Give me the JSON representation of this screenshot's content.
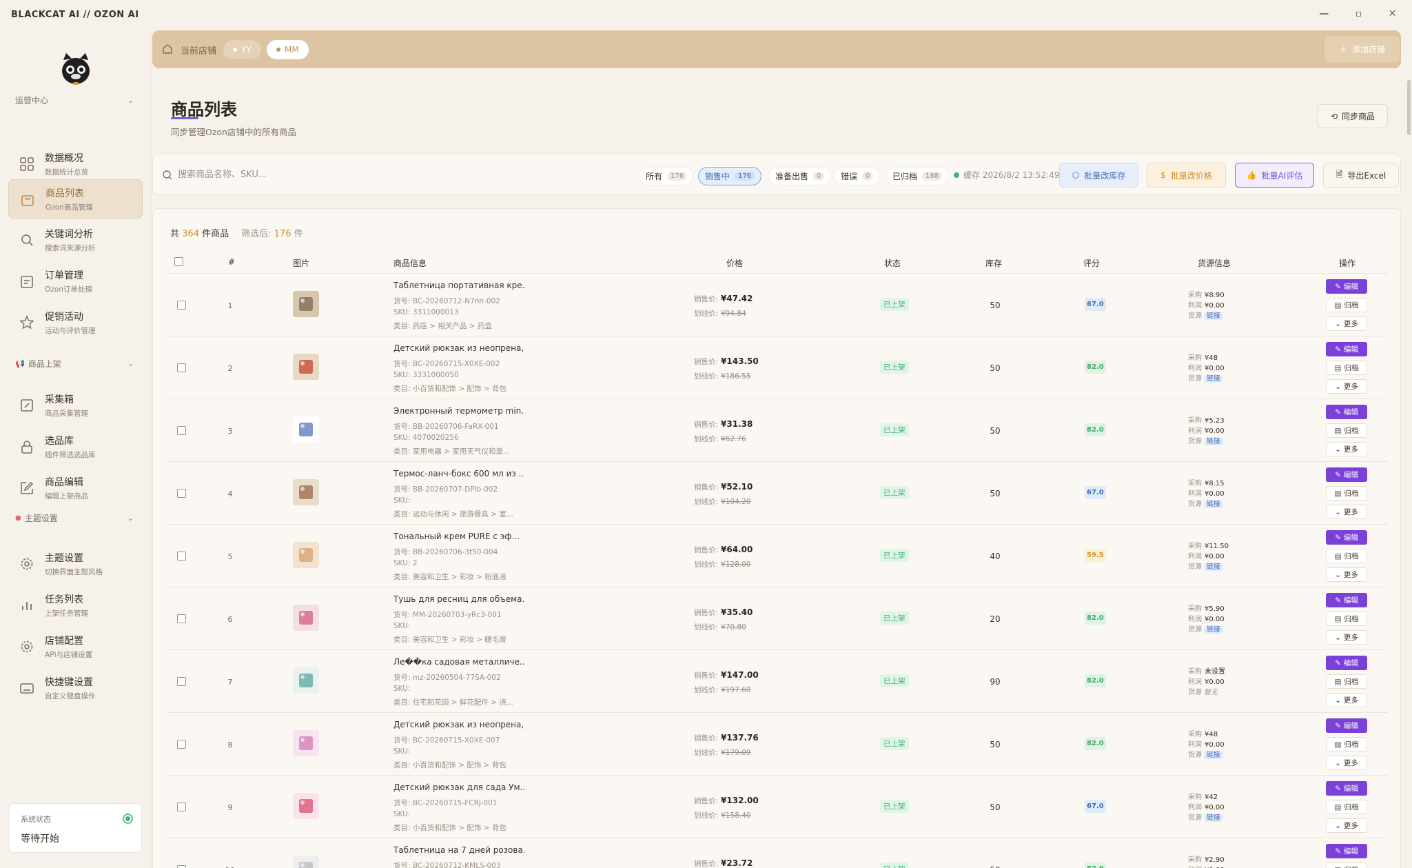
{
  "app": {
    "title": "BLACKCAT AI // OZON AI",
    "min": "—",
    "max": "▫",
    "close": "✕"
  },
  "sidebar": {
    "sections": [
      {
        "label": "运营中心"
      },
      {
        "label": "商品上架"
      },
      {
        "label": "主题设置"
      }
    ],
    "items": [
      {
        "label": "数据概况",
        "sub": "数据统计总览"
      },
      {
        "label": "商品列表",
        "sub": "Ozon商品管理"
      },
      {
        "label": "关键词分析",
        "sub": "搜索词来源分析"
      },
      {
        "label": "订单管理",
        "sub": "Ozon订单处理"
      },
      {
        "label": "促销活动",
        "sub": "活动与评价管理"
      },
      {
        "label": "采集箱",
        "sub": "商品采集管理"
      },
      {
        "label": "选品库",
        "sub": "插件筛选选品库"
      },
      {
        "label": "商品编辑",
        "sub": "编辑上架商品"
      },
      {
        "label": "主题设置",
        "sub": "切换界面主题风格"
      },
      {
        "label": "任务列表",
        "sub": "上架任务管理"
      },
      {
        "label": "店铺配置",
        "sub": "API与店铺设置"
      },
      {
        "label": "快捷键设置",
        "sub": "自定义键盘操作"
      }
    ],
    "status": {
      "label": "系统状态",
      "value": "等待开始"
    }
  },
  "topbar": {
    "current_store": "当前店铺",
    "stores": [
      "YY",
      "MM"
    ],
    "add_store": "添加店铺"
  },
  "page": {
    "title": "商品列表",
    "subtitle": "同步管理Ozon店铺中的所有商品",
    "sync": "同步商品"
  },
  "toolbar": {
    "search_placeholder": "搜索商品名称、SKU...",
    "tabs": [
      {
        "label": "所有",
        "count": "176"
      },
      {
        "label": "销售中",
        "count": "176"
      },
      {
        "label": "准备出售",
        "count": "0"
      },
      {
        "label": "错误",
        "count": "0"
      },
      {
        "label": "已归档",
        "count": "188"
      }
    ],
    "cache": "缓存 2026/8/2 13:52:49",
    "btn_stock": "批量改库存",
    "btn_price": "批量改价格",
    "btn_ai": "批量AI评估",
    "btn_excel": "导出Excel"
  },
  "summary": {
    "prefix": "共",
    "total": "364",
    "suffix": "件商品",
    "filtered_label": "筛选后:",
    "filtered": "176",
    "filtered_unit": "件"
  },
  "table": {
    "headers": [
      "#",
      "图片",
      "商品信息",
      "价格",
      "状态",
      "库存",
      "评分",
      "货源信息",
      "操作"
    ],
    "labels": {
      "sale": "销售价:",
      "strike": "划线价:",
      "buy": "采购",
      "profit": "利润",
      "source": "货源",
      "link": "链接",
      "edit": "编辑",
      "archive": "归档",
      "more": "更多"
    },
    "rows": [
      {
        "idx": "1",
        "name": "Таблетница портативная кре...",
        "code": "货号: BC-20260712-N7nn-002",
        "sku": "SKU: 3311000013",
        "cat": "类目: 药店 > 相关产品 > 药盒",
        "sale": "¥47.42",
        "strike": "¥94.84",
        "status": "已上架",
        "stock": "50",
        "score": "67.0",
        "score_color": "blue",
        "buy": "¥8.90",
        "profit": "¥0.00",
        "src": "链接"
      },
      {
        "idx": "2",
        "name": "Детский рюкзак из неопрена,...",
        "code": "货号: BC-20260715-X0XE-002",
        "sku": "SKU: 3331000050",
        "cat": "类目: 小百货和配饰 > 配饰 > 背包",
        "sale": "¥143.50",
        "strike": "¥186.55",
        "status": "已上架",
        "stock": "50",
        "score": "82.0",
        "score_color": "green",
        "buy": "¥48",
        "profit": "¥0.00",
        "src": "链接"
      },
      {
        "idx": "3",
        "name": "Электронный термометр min...",
        "code": "货号: BB-20260706-FaRX-001",
        "sku": "SKU: 4070020256",
        "cat": "类目: 家用电器 > 家用天气仪和温...",
        "sale": "¥31.38",
        "strike": "¥62.76",
        "status": "已上架",
        "stock": "50",
        "score": "82.0",
        "score_color": "green",
        "buy": "¥5.23",
        "profit": "¥0.00",
        "src": "链接"
      },
      {
        "idx": "4",
        "name": "Термос-ланч-бокс 600 мл из ...",
        "code": "货号: BB-20260707-DPlb-002",
        "sku": "SKU:",
        "cat": "类目: 运动与休闲 > 旅游餐具 > 室...",
        "sale": "¥52.10",
        "strike": "¥104.20",
        "status": "已上架",
        "stock": "50",
        "score": "67.0",
        "score_color": "blue",
        "buy": "¥8.15",
        "profit": "¥0.00",
        "src": "链接"
      },
      {
        "idx": "5",
        "name": "Тональный крем PURE с эф...",
        "code": "货号: BB-20260706-3t50-004",
        "sku": "SKU: 2",
        "cat": "类目: 美容和卫生 > 彩妆 > 粉底液",
        "sale": "¥64.00",
        "strike": "¥128.00",
        "status": "已上架",
        "stock": "40",
        "score": "59.5",
        "score_color": "orange",
        "buy": "¥11.50",
        "profit": "¥0.00",
        "src": "链接"
      },
      {
        "idx": "6",
        "name": "Тушь для ресниц для объема...",
        "code": "货号: MM-20260703-yRc3-001",
        "sku": "SKU:",
        "cat": "类目: 美容和卫生 > 彩妆 > 睫毛膏",
        "sale": "¥35.40",
        "strike": "¥70.80",
        "status": "已上架",
        "stock": "20",
        "score": "82.0",
        "score_color": "green",
        "buy": "¥5.90",
        "profit": "¥0.00",
        "src": "链接"
      },
      {
        "idx": "7",
        "name": "Ле��ка садовая металличе...",
        "code": "货号: mz-20260504-77SA-002",
        "sku": "SKU:",
        "cat": "类目: 住宅和花园 > 鲜花配件 > 浇...",
        "sale": "¥147.00",
        "strike": "¥197.60",
        "status": "已上架",
        "stock": "90",
        "score": "82.0",
        "score_color": "green",
        "buy": "未设置",
        "profit": "¥0.00",
        "src": "暂无"
      },
      {
        "idx": "8",
        "name": "Детский рюкзак из неопрена,...",
        "code": "货号: BC-20260715-X0XE-007",
        "sku": "SKU:",
        "cat": "类目: 小百货和配饰 > 配饰 > 背包",
        "sale": "¥137.76",
        "strike": "¥179.09",
        "status": "已上架",
        "stock": "50",
        "score": "82.0",
        "score_color": "green",
        "buy": "¥48",
        "profit": "¥0.00",
        "src": "链接"
      },
      {
        "idx": "9",
        "name": "Детский рюкзак для сада Ум...",
        "code": "货号: BC-20260715-FCRJ-001",
        "sku": "SKU:",
        "cat": "类目: 小百货和配饰 > 配饰 > 背包",
        "sale": "¥132.00",
        "strike": "¥158.40",
        "status": "已上架",
        "stock": "50",
        "score": "67.0",
        "score_color": "blue",
        "buy": "¥42",
        "profit": "¥0.00",
        "src": "链接"
      },
      {
        "idx": "10",
        "name": "Таблетница на 7 дней розова...",
        "code": "货号: BC-20260712-KMLS-003",
        "sku": "SKU:",
        "cat": "",
        "sale": "¥23.72",
        "strike": "",
        "status": "已上架",
        "stock": "50",
        "score": "82.0",
        "score_color": "green",
        "buy": "¥2.90",
        "profit": "¥0.00",
        "src": "链接"
      }
    ]
  }
}
